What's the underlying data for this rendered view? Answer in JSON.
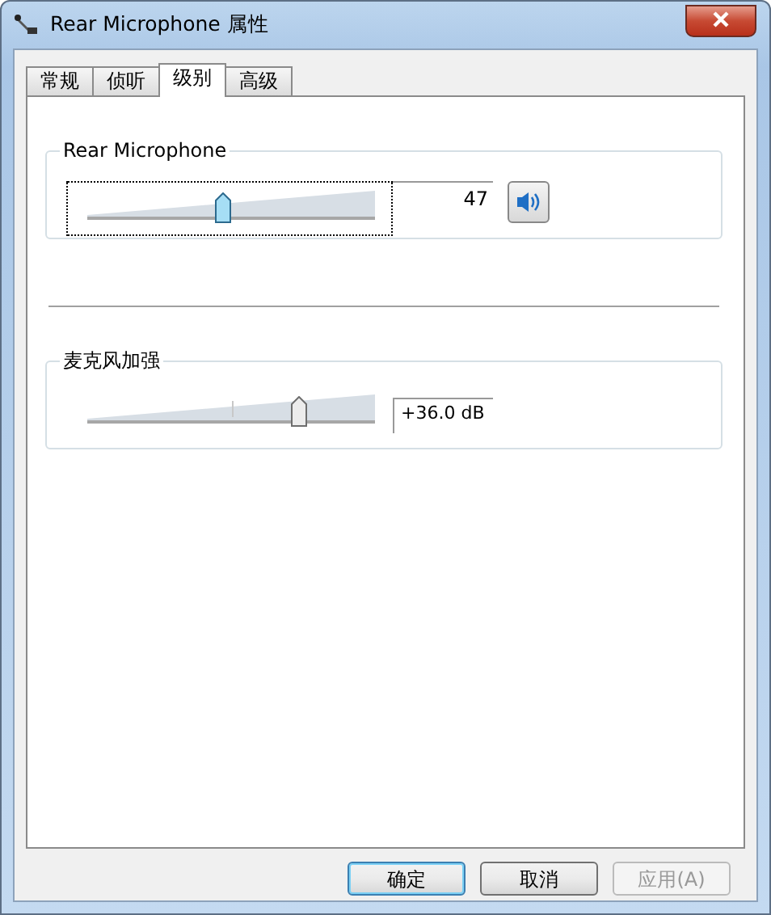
{
  "window": {
    "title": "Rear Microphone 属性"
  },
  "tabs": [
    {
      "label": "常规",
      "selected": false
    },
    {
      "label": "侦听",
      "selected": false
    },
    {
      "label": "级别",
      "selected": true
    },
    {
      "label": "高级",
      "selected": false
    }
  ],
  "levels": {
    "label": "Rear Microphone",
    "level": 0.47,
    "reading": "47",
    "focused": true,
    "muted": false
  },
  "boost": {
    "label": "麦克风加强",
    "level": 0.75,
    "reading": "+36.0 dB",
    "focused": false
  },
  "buttons": [
    {
      "label": "确定",
      "default": true,
      "disabled": false
    },
    {
      "label": "取消",
      "default": false,
      "disabled": false
    },
    {
      "label": "应用(A)",
      "default": false,
      "disabled": true
    }
  ]
}
